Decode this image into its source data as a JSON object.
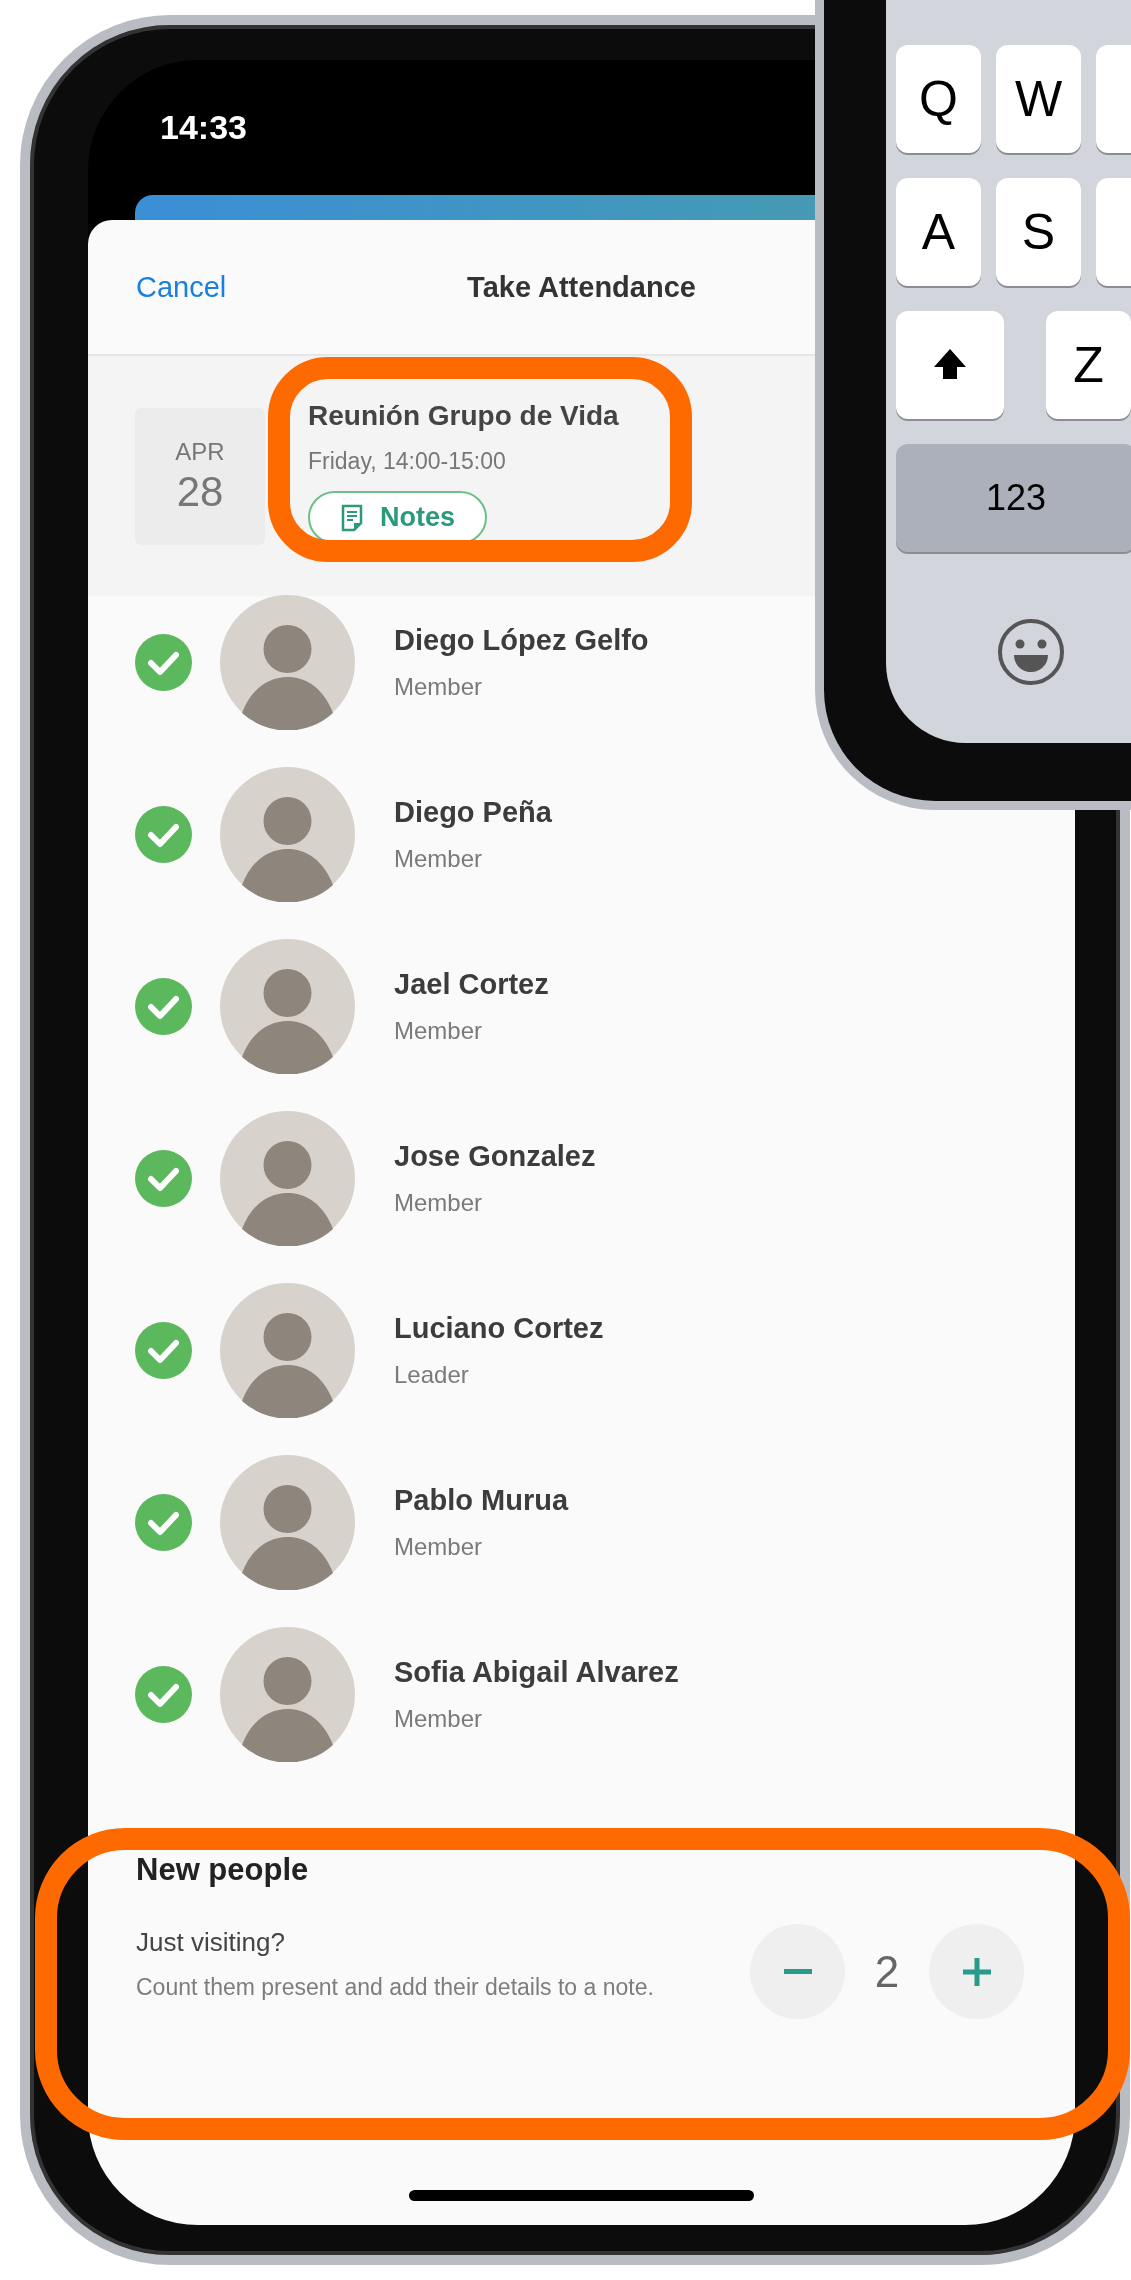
{
  "status_bar": {
    "time": "14:33"
  },
  "header": {
    "cancel": "Cancel",
    "title": "Take Attendance"
  },
  "event": {
    "month": "APR",
    "day": "28",
    "title": "Reunión Grupo de Vida",
    "time": "Friday, 14:00-15:00",
    "notes_button": "Notes"
  },
  "members": [
    {
      "name": "Diego López Gelfo",
      "role": "Member",
      "present": true
    },
    {
      "name": "Diego Peña",
      "role": "Member",
      "present": true
    },
    {
      "name": "Jael Cortez",
      "role": "Member",
      "present": true
    },
    {
      "name": "Jose Gonzalez",
      "role": "Member",
      "present": true
    },
    {
      "name": "Luciano Cortez",
      "role": "Leader",
      "present": true
    },
    {
      "name": "Pablo Murua",
      "role": "Member",
      "present": true
    },
    {
      "name": "Sofia Abigail Alvarez",
      "role": "Member",
      "present": true
    }
  ],
  "new_people": {
    "title": "New people",
    "subtitle": "Just visiting?",
    "description": "Count them present and add their details to a note.",
    "count": "2"
  },
  "keyboard": {
    "rows": [
      [
        {
          "kind": "letter",
          "label": "Q"
        },
        {
          "kind": "letter",
          "label": "W"
        },
        {
          "kind": "partial"
        }
      ],
      [
        {
          "kind": "letter",
          "label": "A"
        },
        {
          "kind": "letter",
          "label": "S"
        },
        {
          "kind": "partial"
        }
      ],
      [
        {
          "kind": "shift"
        },
        {
          "kind": "letter",
          "label": "Z"
        }
      ]
    ],
    "numbers_key": "123"
  }
}
